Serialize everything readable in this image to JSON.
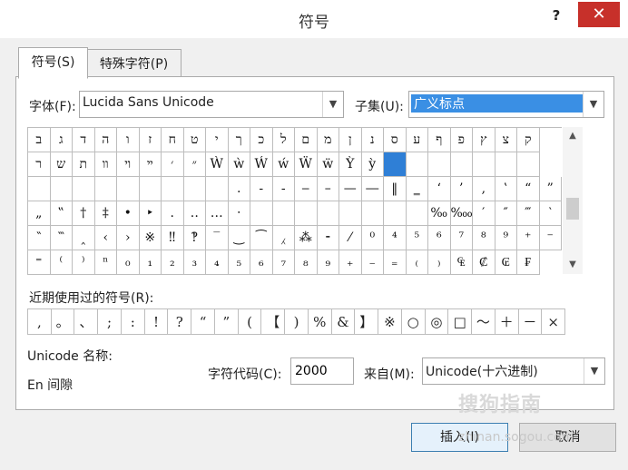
{
  "window": {
    "title": "符号",
    "help": "?",
    "close": "✕"
  },
  "tabs": [
    {
      "label": "符号(S)"
    },
    {
      "label": "特殊字符(P)"
    }
  ],
  "font": {
    "label": "字体(F):",
    "value": "Lucida Sans Unicode"
  },
  "subset": {
    "label": "子集(U):",
    "value": "广义标点"
  },
  "grid_rows": [
    [
      "ב",
      "ג",
      "ד",
      "ה",
      "ו",
      "ז",
      "ח",
      "ט",
      "י",
      "ך",
      "כ",
      "ל",
      "ם",
      "מ",
      "ן",
      "נ",
      "ס",
      "ע",
      "ף",
      "פ",
      "ץ",
      "צ",
      "ק"
    ],
    [
      "ר",
      "ש",
      "ת",
      "װ",
      "ױ",
      "ײ",
      "׳",
      "״",
      "Ẁ",
      "ẁ",
      "Ẃ",
      "ẃ",
      "Ẅ",
      "ẅ",
      "Ỳ",
      "ỳ",
      " ",
      "",
      "",
      "",
      "",
      "",
      ""
    ],
    [
      "",
      "",
      "",
      "",
      "",
      "",
      "",
      "",
      "",
      ".",
      "-",
      "‑",
      "‒",
      "–",
      "—",
      "―",
      "‖",
      "‗",
      "‘",
      "’",
      "‚",
      "‛",
      "“",
      "”"
    ],
    [
      "„",
      "‟",
      "†",
      "‡",
      "•",
      "‣",
      "․",
      "‥",
      "…",
      "‧",
      "",
      "",
      "",
      "",
      "",
      "",
      "",
      "",
      "‰",
      "‱",
      "′",
      "″",
      "‴",
      "‵"
    ],
    [
      "‶",
      "‷",
      "‸",
      "‹",
      "›",
      "※",
      "‼",
      "‽",
      "‾",
      "‿",
      "⁀",
      "⁁",
      "⁂",
      "⁃",
      "⁄",
      "⁰",
      "⁴",
      "⁵",
      "⁶",
      "⁷",
      "⁸",
      "⁹",
      "⁺",
      "⁻"
    ],
    [
      "⁼",
      "⁽",
      "⁾",
      "ⁿ",
      "₀",
      "₁",
      "₂",
      "₃",
      "₄",
      "₅",
      "₆",
      "₇",
      "₈",
      "₉",
      "₊",
      "₋",
      "₌",
      "₍",
      "₎",
      "₠",
      "₡",
      "₢",
      "₣"
    ]
  ],
  "recent": {
    "label": "近期使用过的符号(R):",
    "symbols": [
      ",",
      "。",
      "、",
      ";",
      ":",
      "!",
      "?",
      "“",
      "”",
      "(",
      "【",
      ")",
      "%",
      "&",
      "】",
      "※",
      "○",
      "◎",
      "□",
      "～",
      "＋",
      "－",
      "×"
    ]
  },
  "unicode_name": {
    "label": "Unicode 名称:",
    "value": "En 间隙"
  },
  "char_code": {
    "label": "字符代码(C):",
    "value": "2000"
  },
  "from": {
    "label": "来自(M):",
    "value": "Unicode(十六进制)"
  },
  "buttons": {
    "insert": "插入(I)",
    "cancel": "取消"
  },
  "watermark": {
    "text": "搜狗指南",
    "url": "zhinan.sogou.com"
  }
}
